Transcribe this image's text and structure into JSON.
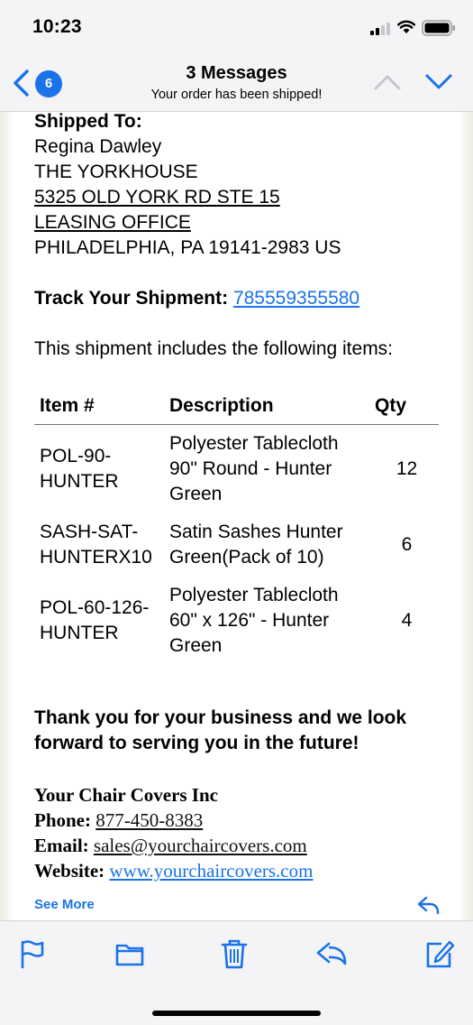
{
  "status_bar": {
    "time": "10:23"
  },
  "nav": {
    "badge_count": "6",
    "title": "3 Messages",
    "subtitle": "Your order has been shipped!"
  },
  "shipping": {
    "heading": "Shipped To:",
    "name": "Regina Dawley",
    "company": "THE YORKHOUSE",
    "street": "5325 OLD YORK RD STE 15",
    "suite": "LEASING OFFICE",
    "city_line": "PHILADELPHIA, PA 19141-2983 US"
  },
  "tracking": {
    "label": "Track Your Shipment:",
    "number": "785559355580"
  },
  "intro_text": "This shipment includes the following items:",
  "items_table": {
    "headers": {
      "item": "Item #",
      "description": "Description",
      "qty": "Qty"
    },
    "rows": [
      {
        "item_line1": "POL-90-",
        "item_line2": "HUNTER",
        "desc_line1": "Polyester Tablecloth",
        "desc_line2": "90\" Round - Hunter",
        "desc_line3": "Green",
        "qty": "12"
      },
      {
        "item_line1": "SASH-SAT-",
        "item_line2": "HUNTERX10",
        "desc_line1": "Satin Sashes Hunter",
        "desc_line2": "Green(Pack of 10)",
        "desc_line3": "",
        "qty": "6"
      },
      {
        "item_line1": "POL-60-126-",
        "item_line2": "HUNTER",
        "desc_line1": "Polyester Tablecloth",
        "desc_line2": "60\" x 126\" - Hunter",
        "desc_line3": "Green",
        "qty": "4"
      }
    ]
  },
  "thank_you": {
    "line1": "Thank you for your business and we look",
    "line2": "forward to serving you in the future!"
  },
  "company": {
    "name": "Your Chair Covers Inc",
    "phone_label": "Phone:",
    "phone": "877-450-8383",
    "email_label": "Email:",
    "email": "sales@yourchaircovers.com",
    "website_label": "Website:",
    "website": "www.yourchaircovers.com"
  },
  "see_more": "See More",
  "colors": {
    "accent": "#1a73e8",
    "bar_background": "#f4f4f6"
  },
  "icons": {
    "toolbar": [
      "flag-icon",
      "folder-icon",
      "trash-icon",
      "reply-icon",
      "compose-icon"
    ]
  }
}
